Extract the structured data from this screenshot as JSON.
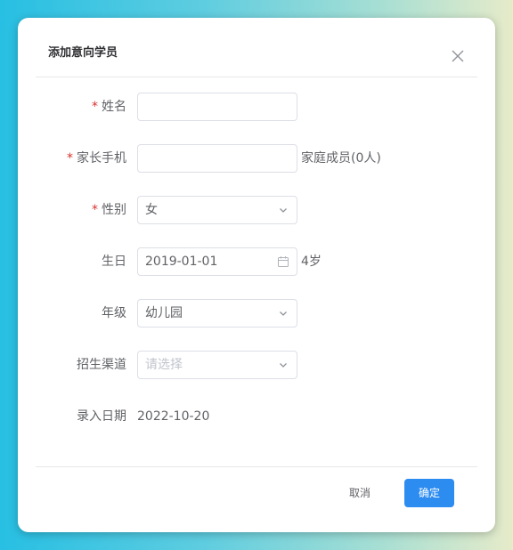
{
  "dialog": {
    "title": "添加意向学员",
    "close_icon": "close-icon"
  },
  "form": {
    "name": {
      "required": true,
      "label": "姓名",
      "value": ""
    },
    "parent_phone": {
      "required": true,
      "label": "家长手机",
      "value": "",
      "after": "家庭成员(0人)"
    },
    "gender": {
      "required": true,
      "label": "性别",
      "value": "女",
      "icon": "chevron-down-icon"
    },
    "birthday": {
      "required": false,
      "label": "生日",
      "value": "2019-01-01",
      "icon": "calendar-icon",
      "after": "4岁"
    },
    "grade": {
      "required": false,
      "label": "年级",
      "value": "幼儿园",
      "icon": "chevron-down-icon"
    },
    "channel": {
      "required": false,
      "label": "招生渠道",
      "placeholder": "请选择",
      "icon": "chevron-down-icon"
    },
    "entry_date": {
      "required": false,
      "label": "录入日期",
      "value": "2022-10-20"
    }
  },
  "footer": {
    "cancel_label": "取消",
    "ok_label": "确定"
  },
  "colors": {
    "required": "#d9302c",
    "primary": "#2d8cf0",
    "text": "#606266",
    "placeholder": "#c0c4cc",
    "border": "#dcdfe6"
  }
}
